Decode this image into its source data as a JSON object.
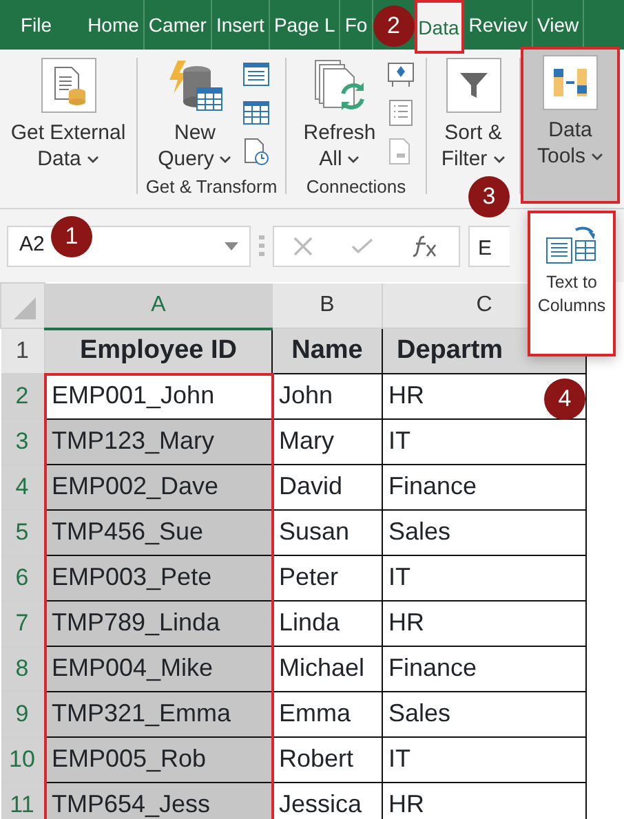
{
  "ribbon_tabs": [
    {
      "label": "File",
      "selected": false
    },
    {
      "label": "Home",
      "selected": false
    },
    {
      "label": "Camer",
      "selected": false
    },
    {
      "label": "Insert",
      "selected": false
    },
    {
      "label": "Page L",
      "selected": false
    },
    {
      "label": "Fo",
      "selected": false
    },
    {
      "label": "Data",
      "selected": true
    },
    {
      "label": "Reviev",
      "selected": false
    },
    {
      "label": "View",
      "selected": false
    }
  ],
  "ribbon_groups": [
    {
      "kind": "external",
      "buttons": [
        {
          "label": "Get External Data",
          "selected": false
        }
      ]
    },
    {
      "kind": "transform",
      "label": "Get & Transform",
      "buttons": [
        {
          "label": "New Query",
          "selected": false
        }
      ]
    },
    {
      "kind": "connections",
      "label": "Connections",
      "buttons": [
        {
          "label": "Refresh All",
          "selected": false
        }
      ]
    },
    {
      "kind": "sort",
      "buttons": [
        {
          "label": "Sort & Filter",
          "selected": false
        }
      ]
    },
    {
      "kind": "tools",
      "buttons": [
        {
          "label": "Data Tools",
          "selected": true
        }
      ]
    }
  ],
  "formula_bar": {
    "name_box": "A2",
    "value": "E"
  },
  "dropdown": {
    "label": "Text to Columns"
  },
  "sheet": {
    "columns": [
      {
        "label": "A",
        "selected": true
      },
      {
        "label": "B",
        "selected": false
      },
      {
        "label": "C",
        "selected": false
      }
    ],
    "rows": [
      {
        "number": "1",
        "kind": "header",
        "selected": false,
        "cells": [
          "Employee ID",
          "Name",
          "Departm"
        ]
      },
      {
        "number": "2",
        "kind": "data",
        "selected": true,
        "active": true,
        "cells": [
          "EMP001_John",
          "John",
          "HR"
        ]
      },
      {
        "number": "3",
        "kind": "data",
        "selected": true,
        "active": false,
        "cells": [
          "TMP123_Mary",
          "Mary",
          "IT"
        ]
      },
      {
        "number": "4",
        "kind": "data",
        "selected": true,
        "active": false,
        "cells": [
          "EMP002_Dave",
          "David",
          "Finance"
        ]
      },
      {
        "number": "5",
        "kind": "data",
        "selected": true,
        "active": false,
        "cells": [
          "TMP456_Sue",
          "Susan",
          "Sales"
        ]
      },
      {
        "number": "6",
        "kind": "data",
        "selected": true,
        "active": false,
        "cells": [
          "EMP003_Pete",
          "Peter",
          "IT"
        ]
      },
      {
        "number": "7",
        "kind": "data",
        "selected": true,
        "active": false,
        "cells": [
          "TMP789_Linda",
          "Linda",
          "HR"
        ]
      },
      {
        "number": "8",
        "kind": "data",
        "selected": true,
        "active": false,
        "cells": [
          "EMP004_Mike",
          "Michael",
          "Finance"
        ]
      },
      {
        "number": "9",
        "kind": "data",
        "selected": true,
        "active": false,
        "cells": [
          "TMP321_Emma",
          "Emma",
          "Sales"
        ]
      },
      {
        "number": "10",
        "kind": "data",
        "selected": true,
        "active": false,
        "cells": [
          "EMP005_Rob",
          "Robert",
          "IT"
        ]
      },
      {
        "number": "11",
        "kind": "data",
        "selected": true,
        "active": false,
        "cells": [
          "TMP654_Jess",
          "Jessica",
          "HR"
        ]
      }
    ]
  },
  "callouts": [
    "1",
    "2",
    "3",
    "4"
  ]
}
